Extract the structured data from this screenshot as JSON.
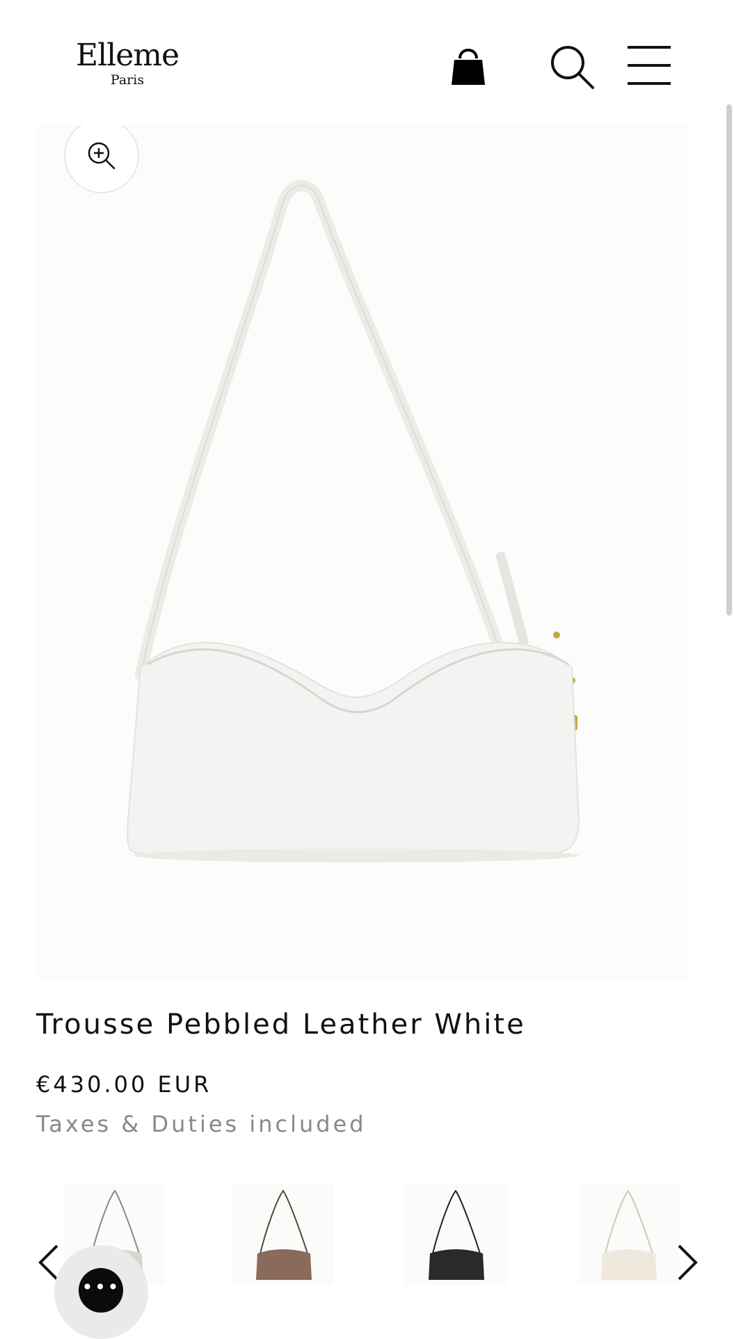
{
  "header": {
    "logo_main": "Elleme",
    "logo_sub": "Paris",
    "icons": [
      "shopping-bag-icon",
      "search-icon",
      "menu-icon"
    ]
  },
  "gallery": {
    "zoom_icon": "zoom-in-icon",
    "product_color": "#f4f4f2"
  },
  "product": {
    "title": "Trousse Pebbled Leather White",
    "price": "€430.00 EUR",
    "tax_note": "Taxes & Duties included"
  },
  "variants": {
    "prev_icon": "chevron-left-icon",
    "next_icon": "chevron-right-icon",
    "colors": [
      "#d9d6d0",
      "#8a6a5a",
      "#2a2a2a",
      "#efe9dd"
    ]
  },
  "chat": {
    "icon": "chat-bubble-icon",
    "glyph": "•••"
  }
}
